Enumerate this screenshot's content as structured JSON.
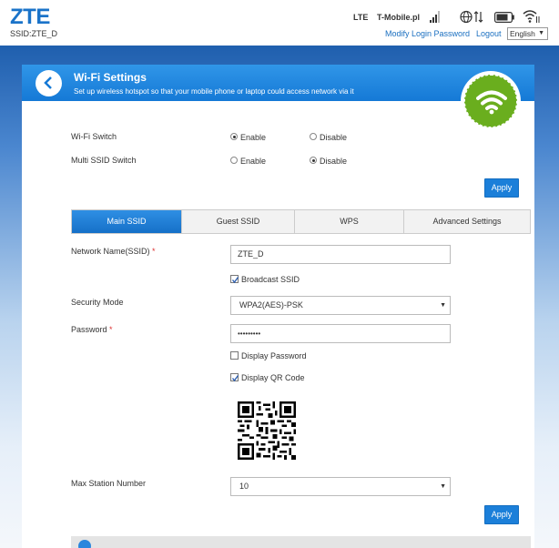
{
  "header": {
    "logo": "ZTE",
    "ssid_label": "SSID:ZTE_D",
    "network_type": "LTE",
    "carrier": "T-Mobile.pl",
    "modify_password_link": "Modify Login Password",
    "logout_link": "Logout",
    "language": "English",
    "icons": [
      "signal-icon",
      "globe-data-icon",
      "battery-icon",
      "wifi-icon"
    ]
  },
  "page": {
    "title": "Wi-Fi Settings",
    "subtitle": "Set up wireless hotspot so that your mobile phone or laptop could access network via it"
  },
  "switches": {
    "wifi_switch_label": "Wi-Fi Switch",
    "multi_ssid_label": "Multi SSID Switch",
    "enable_label": "Enable",
    "disable_label": "Disable",
    "wifi_switch_value": "Enable",
    "multi_ssid_value": "Disable",
    "apply_label": "Apply"
  },
  "tabs": [
    {
      "label": "Main SSID",
      "active": true
    },
    {
      "label": "Guest SSID",
      "active": false
    },
    {
      "label": "WPS",
      "active": false
    },
    {
      "label": "Advanced Settings",
      "active": false
    }
  ],
  "form": {
    "network_name_label": "Network Name(SSID)",
    "required_mark": "*",
    "network_name_value": "ZTE_D",
    "broadcast_ssid_label": "Broadcast SSID",
    "broadcast_ssid_checked": true,
    "security_mode_label": "Security Mode",
    "security_mode_value": "WPA2(AES)-PSK",
    "password_label": "Password",
    "password_value": "•••••••••",
    "display_password_label": "Display Password",
    "display_password_checked": false,
    "display_qr_label": "Display QR Code",
    "display_qr_checked": true,
    "max_station_label": "Max Station Number",
    "max_station_value": "10",
    "apply_label": "Apply"
  },
  "colors": {
    "accent": "#1b7fd9",
    "header_blue": "#1579d6",
    "wifi_green": "#6aae1e"
  }
}
